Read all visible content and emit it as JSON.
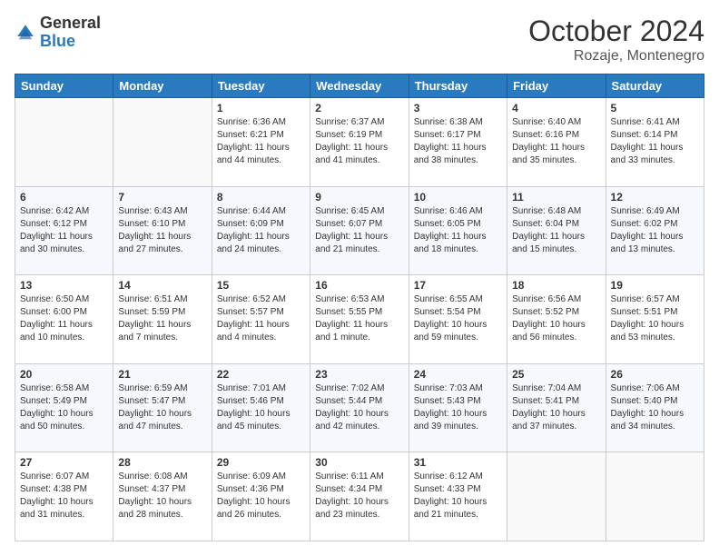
{
  "header": {
    "logo_general": "General",
    "logo_blue": "Blue",
    "title": "October 2024",
    "subtitle": "Rozaje, Montenegro"
  },
  "weekdays": [
    "Sunday",
    "Monday",
    "Tuesday",
    "Wednesday",
    "Thursday",
    "Friday",
    "Saturday"
  ],
  "weeks": [
    [
      {
        "day": "",
        "info": ""
      },
      {
        "day": "",
        "info": ""
      },
      {
        "day": "1",
        "info": "Sunrise: 6:36 AM\nSunset: 6:21 PM\nDaylight: 11 hours and 44 minutes."
      },
      {
        "day": "2",
        "info": "Sunrise: 6:37 AM\nSunset: 6:19 PM\nDaylight: 11 hours and 41 minutes."
      },
      {
        "day": "3",
        "info": "Sunrise: 6:38 AM\nSunset: 6:17 PM\nDaylight: 11 hours and 38 minutes."
      },
      {
        "day": "4",
        "info": "Sunrise: 6:40 AM\nSunset: 6:16 PM\nDaylight: 11 hours and 35 minutes."
      },
      {
        "day": "5",
        "info": "Sunrise: 6:41 AM\nSunset: 6:14 PM\nDaylight: 11 hours and 33 minutes."
      }
    ],
    [
      {
        "day": "6",
        "info": "Sunrise: 6:42 AM\nSunset: 6:12 PM\nDaylight: 11 hours and 30 minutes."
      },
      {
        "day": "7",
        "info": "Sunrise: 6:43 AM\nSunset: 6:10 PM\nDaylight: 11 hours and 27 minutes."
      },
      {
        "day": "8",
        "info": "Sunrise: 6:44 AM\nSunset: 6:09 PM\nDaylight: 11 hours and 24 minutes."
      },
      {
        "day": "9",
        "info": "Sunrise: 6:45 AM\nSunset: 6:07 PM\nDaylight: 11 hours and 21 minutes."
      },
      {
        "day": "10",
        "info": "Sunrise: 6:46 AM\nSunset: 6:05 PM\nDaylight: 11 hours and 18 minutes."
      },
      {
        "day": "11",
        "info": "Sunrise: 6:48 AM\nSunset: 6:04 PM\nDaylight: 11 hours and 15 minutes."
      },
      {
        "day": "12",
        "info": "Sunrise: 6:49 AM\nSunset: 6:02 PM\nDaylight: 11 hours and 13 minutes."
      }
    ],
    [
      {
        "day": "13",
        "info": "Sunrise: 6:50 AM\nSunset: 6:00 PM\nDaylight: 11 hours and 10 minutes."
      },
      {
        "day": "14",
        "info": "Sunrise: 6:51 AM\nSunset: 5:59 PM\nDaylight: 11 hours and 7 minutes."
      },
      {
        "day": "15",
        "info": "Sunrise: 6:52 AM\nSunset: 5:57 PM\nDaylight: 11 hours and 4 minutes."
      },
      {
        "day": "16",
        "info": "Sunrise: 6:53 AM\nSunset: 5:55 PM\nDaylight: 11 hours and 1 minute."
      },
      {
        "day": "17",
        "info": "Sunrise: 6:55 AM\nSunset: 5:54 PM\nDaylight: 10 hours and 59 minutes."
      },
      {
        "day": "18",
        "info": "Sunrise: 6:56 AM\nSunset: 5:52 PM\nDaylight: 10 hours and 56 minutes."
      },
      {
        "day": "19",
        "info": "Sunrise: 6:57 AM\nSunset: 5:51 PM\nDaylight: 10 hours and 53 minutes."
      }
    ],
    [
      {
        "day": "20",
        "info": "Sunrise: 6:58 AM\nSunset: 5:49 PM\nDaylight: 10 hours and 50 minutes."
      },
      {
        "day": "21",
        "info": "Sunrise: 6:59 AM\nSunset: 5:47 PM\nDaylight: 10 hours and 47 minutes."
      },
      {
        "day": "22",
        "info": "Sunrise: 7:01 AM\nSunset: 5:46 PM\nDaylight: 10 hours and 45 minutes."
      },
      {
        "day": "23",
        "info": "Sunrise: 7:02 AM\nSunset: 5:44 PM\nDaylight: 10 hours and 42 minutes."
      },
      {
        "day": "24",
        "info": "Sunrise: 7:03 AM\nSunset: 5:43 PM\nDaylight: 10 hours and 39 minutes."
      },
      {
        "day": "25",
        "info": "Sunrise: 7:04 AM\nSunset: 5:41 PM\nDaylight: 10 hours and 37 minutes."
      },
      {
        "day": "26",
        "info": "Sunrise: 7:06 AM\nSunset: 5:40 PM\nDaylight: 10 hours and 34 minutes."
      }
    ],
    [
      {
        "day": "27",
        "info": "Sunrise: 6:07 AM\nSunset: 4:38 PM\nDaylight: 10 hours and 31 minutes."
      },
      {
        "day": "28",
        "info": "Sunrise: 6:08 AM\nSunset: 4:37 PM\nDaylight: 10 hours and 28 minutes."
      },
      {
        "day": "29",
        "info": "Sunrise: 6:09 AM\nSunset: 4:36 PM\nDaylight: 10 hours and 26 minutes."
      },
      {
        "day": "30",
        "info": "Sunrise: 6:11 AM\nSunset: 4:34 PM\nDaylight: 10 hours and 23 minutes."
      },
      {
        "day": "31",
        "info": "Sunrise: 6:12 AM\nSunset: 4:33 PM\nDaylight: 10 hours and 21 minutes."
      },
      {
        "day": "",
        "info": ""
      },
      {
        "day": "",
        "info": ""
      }
    ]
  ]
}
